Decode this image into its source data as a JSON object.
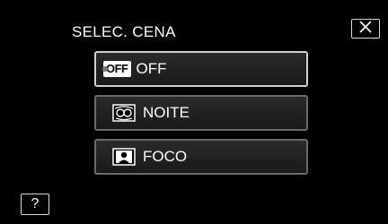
{
  "header": {
    "title": "SELEC. CENA",
    "close_icon": "close-x-icon"
  },
  "menu": {
    "items": [
      {
        "icon": "off-icon",
        "icon_text": "OFF",
        "label": "OFF",
        "selected": true
      },
      {
        "icon": "night-scene-icon",
        "label": "NOITE",
        "selected": false
      },
      {
        "icon": "spotlight-icon",
        "label": "FOCO",
        "selected": false
      }
    ]
  },
  "footer": {
    "help_label": "?"
  },
  "colors": {
    "background": "#000000",
    "item_border": "#6b6b6b",
    "selected_border": "#d0d0d0",
    "text": "#ffffff"
  }
}
